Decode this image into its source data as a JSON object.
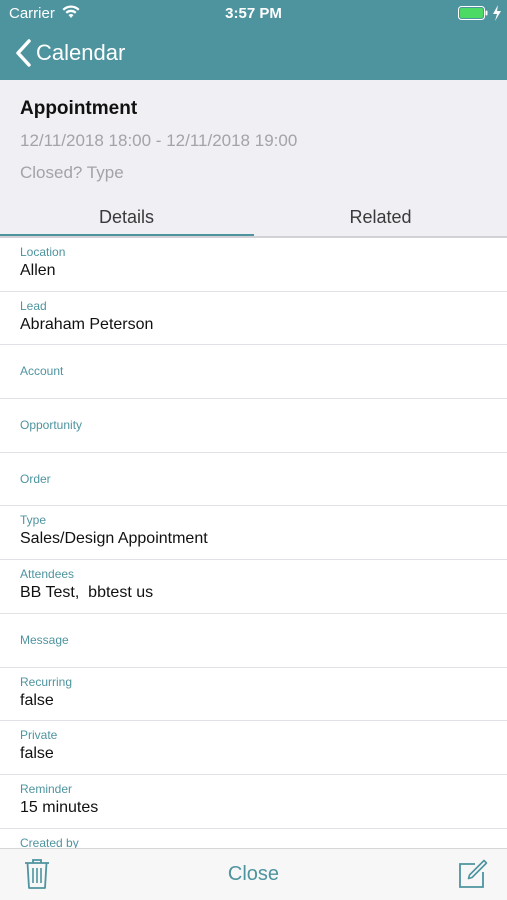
{
  "status_bar": {
    "carrier": "Carrier",
    "time": "3:57 PM"
  },
  "nav": {
    "back_label": "Calendar"
  },
  "appointment": {
    "title": "Appointment",
    "date_range": "12/11/2018 18:00 - 12/11/2018 19:00",
    "closed_type": "Closed? Type"
  },
  "tabs": [
    {
      "label": "Details",
      "active": true
    },
    {
      "label": "Related",
      "active": false
    }
  ],
  "fields": [
    {
      "label": "Location",
      "value": "Allen"
    },
    {
      "label": "Lead",
      "value": "Abraham Peterson"
    },
    {
      "label": "Account",
      "value": ""
    },
    {
      "label": "Opportunity",
      "value": ""
    },
    {
      "label": "Order",
      "value": ""
    },
    {
      "label": "Type",
      "value": "Sales/Design Appointment"
    },
    {
      "label": "Attendees",
      "value": "BB Test,  bbtest us"
    },
    {
      "label": "Message",
      "value": ""
    },
    {
      "label": "Recurring",
      "value": "false"
    },
    {
      "label": "Private",
      "value": "false"
    },
    {
      "label": "Reminder",
      "value": "15 minutes"
    },
    {
      "label": "Created by",
      "value": ""
    }
  ],
  "toolbar": {
    "close_label": "Close",
    "delete_icon": "trash-icon",
    "edit_icon": "edit-icon"
  },
  "colors": {
    "accent": "#4e949f",
    "header_bg": "#efeff4",
    "battery": "#4cd964"
  }
}
